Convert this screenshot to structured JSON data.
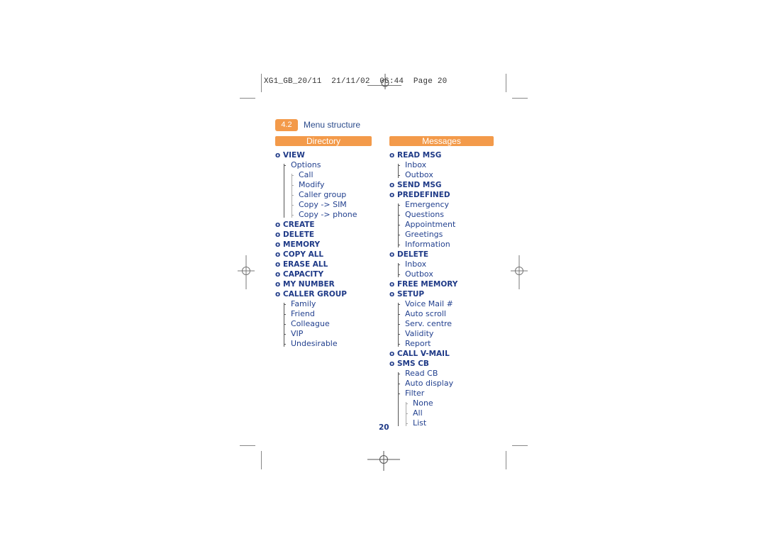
{
  "slug": {
    "text": "XG1_GB_20/11  21/11/02  06:44  Page 20"
  },
  "section": {
    "number": "4.2",
    "title": "Menu structure"
  },
  "columns": [
    {
      "header": "Directory",
      "items": [
        {
          "label": "VIEW",
          "children": [
            {
              "label": "Options",
              "children": [
                {
                  "label": "Call"
                },
                {
                  "label": "Modify"
                },
                {
                  "label": "Caller group"
                },
                {
                  "label": "Copy -> SIM"
                },
                {
                  "label": "Copy -> phone"
                }
              ]
            }
          ]
        },
        {
          "label": "CREATE"
        },
        {
          "label": "DELETE"
        },
        {
          "label": "MEMORY"
        },
        {
          "label": "COPY ALL"
        },
        {
          "label": "ERASE ALL"
        },
        {
          "label": "CAPACITY"
        },
        {
          "label": "MY NUMBER"
        },
        {
          "label": "CALLER GROUP",
          "children": [
            {
              "label": "Family"
            },
            {
              "label": "Friend"
            },
            {
              "label": "Colleague"
            },
            {
              "label": "VIP"
            },
            {
              "label": "Undesirable"
            }
          ]
        }
      ]
    },
    {
      "header": "Messages",
      "items": [
        {
          "label": "READ MSG",
          "children": [
            {
              "label": "Inbox"
            },
            {
              "label": "Outbox"
            }
          ]
        },
        {
          "label": "SEND MSG"
        },
        {
          "label": "PREDEFINED",
          "children": [
            {
              "label": "Emergency"
            },
            {
              "label": "Questions"
            },
            {
              "label": "Appointment"
            },
            {
              "label": "Greetings"
            },
            {
              "label": "Information"
            }
          ]
        },
        {
          "label": "DELETE",
          "children": [
            {
              "label": "Inbox"
            },
            {
              "label": "Outbox"
            }
          ]
        },
        {
          "label": "FREE MEMORY"
        },
        {
          "label": "SETUP",
          "children": [
            {
              "label": "Voice Mail #"
            },
            {
              "label": "Auto scroll"
            },
            {
              "label": "Serv. centre"
            },
            {
              "label": "Validity"
            },
            {
              "label": "Report"
            }
          ]
        },
        {
          "label": "CALL V-MAIL"
        },
        {
          "label": "SMS CB",
          "children": [
            {
              "label": "Read CB"
            },
            {
              "label": "Auto display"
            },
            {
              "label": "Filter",
              "children": [
                {
                  "label": "None"
                },
                {
                  "label": "All"
                },
                {
                  "label": "List"
                }
              ]
            }
          ]
        }
      ]
    }
  ],
  "bullet": "o",
  "page_number": "20",
  "colors": {
    "accent": "#f39a4a",
    "text": "#1f3a87"
  }
}
